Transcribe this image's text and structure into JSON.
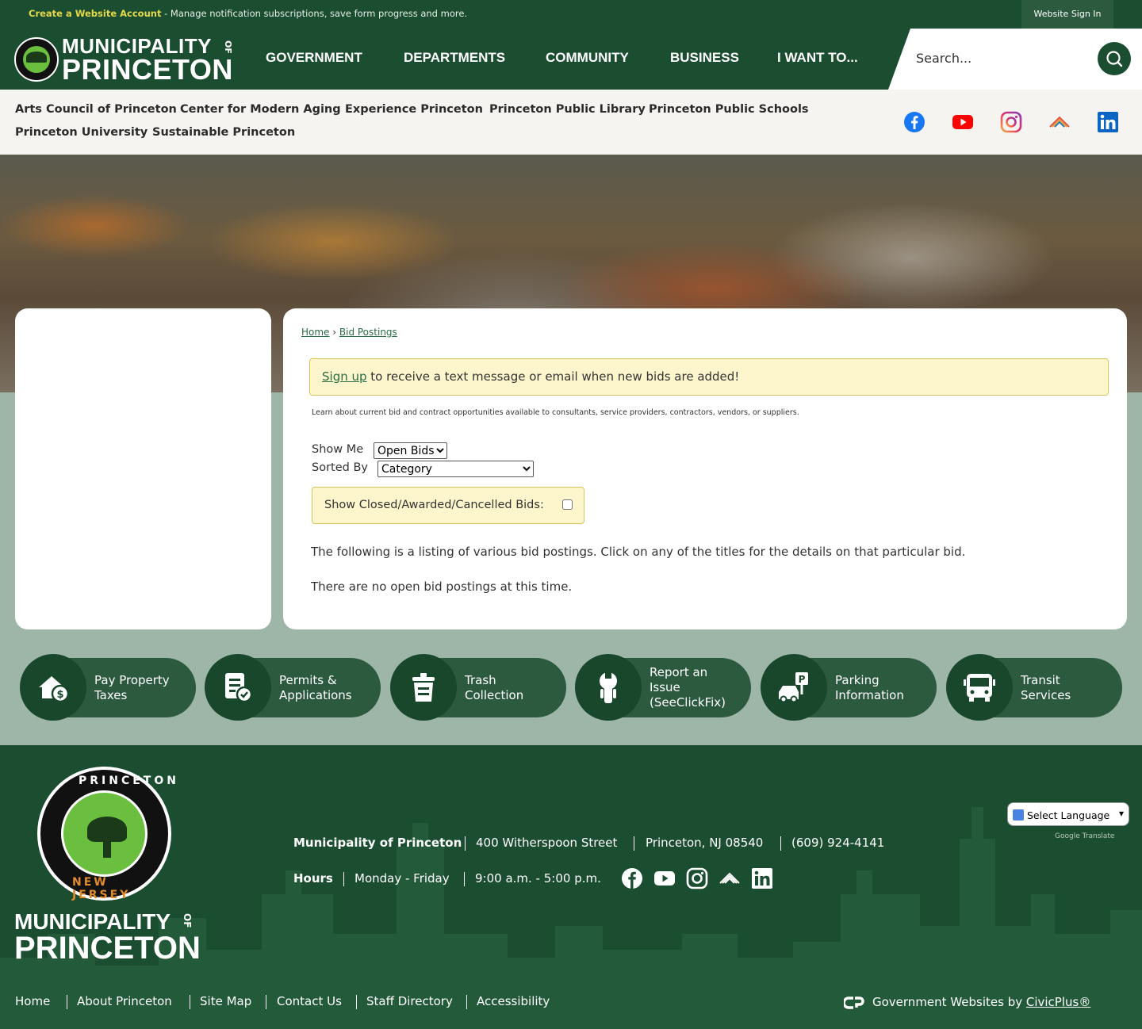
{
  "topbar": {
    "create_account": "Create a Website Account",
    "message": " - Manage notification subscriptions, save form progress and more.",
    "sign_in": "Website Sign In"
  },
  "header": {
    "logo_line1": "MUNICIPALITY",
    "logo_line2": "PRINCETON",
    "logo_of": "OF",
    "nav": [
      "GOVERNMENT",
      "DEPARTMENTS",
      "COMMUNITY",
      "BUSINESS",
      "I WANT TO..."
    ],
    "search_placeholder": "Search..."
  },
  "quick_links": [
    "Arts Council of Princeton",
    "Center for Modern Aging",
    "Experience Princeton",
    "Princeton Public Library",
    "Princeton Public Schools",
    "Princeton University",
    "Sustainable Princeton"
  ],
  "social_icons": [
    "facebook-icon",
    "youtube-icon",
    "instagram-icon",
    "nextdoor-icon",
    "linkedin-icon"
  ],
  "breadcrumb": {
    "home": "Home",
    "sep": " › ",
    "current": "Bid Postings"
  },
  "alert": {
    "link": "Sign up",
    "text": " to receive a text message or email when new bids are added!"
  },
  "learn_text": "Learn about current bid and contract opportunities available to consultants, service providers, contractors, vendors, or suppliers.",
  "filters": {
    "show_me_label": "Show Me",
    "show_me_value": "Open Bids",
    "sorted_by_label": "Sorted By",
    "sorted_by_value": "Category",
    "closed_label": "Show Closed/Awarded/Cancelled Bids:"
  },
  "listing_text": "The following is a listing of various bid postings. Click on any of the titles for the details on that particular bid.",
  "no_bids_text": "There are no open bid postings at this time.",
  "quick_actions": [
    {
      "label": "Pay Property Taxes",
      "line1": "Pay Property",
      "line2": "Taxes",
      "icon": "house-dollar-icon"
    },
    {
      "label": "Permits & Applications",
      "line1": "Permits &",
      "line2": "Applications",
      "icon": "permit-document-icon"
    },
    {
      "label": "Trash Collection",
      "line1": "Trash",
      "line2": "Collection",
      "icon": "trash-can-icon"
    },
    {
      "label": "Report an Issue (SeeClickFix)",
      "line1": "Report an",
      "line2": "Issue",
      "line3": "(SeeClickFix)",
      "icon": "wrench-icon"
    },
    {
      "label": "Parking Information",
      "line1": "Parking",
      "line2": "Information",
      "icon": "parking-car-icon"
    },
    {
      "label": "Transit Services",
      "line1": "Transit",
      "line2": "Services",
      "icon": "bus-icon"
    }
  ],
  "footer": {
    "seal_top": "PRINCETON",
    "seal_bottom": "NEW JERSEY",
    "name_line1": "MUNICIPALITY",
    "name_line2": "PRINCETON",
    "name_of": "OF",
    "org": "Municipality of Princeton",
    "street": "400 Witherspoon Street",
    "city": "Princeton, NJ 08540",
    "phone": "(609) 924-4141",
    "hours_label": "Hours",
    "days": "Monday - Friday",
    "time": "9:00 a.m. - 5:00 p.m.",
    "language": "Select Language",
    "powered": "Google Translate",
    "links": [
      "Home",
      "About Princeton",
      "Site Map",
      "Contact Us",
      "Staff Directory",
      "Accessibility"
    ],
    "civic_text": "Government Websites by ",
    "civic_link": "CivicPlus®"
  },
  "colors": {
    "brand_green": "#1b4d31",
    "accent_yellow": "#e4d84a",
    "alert_bg": "#fdf6cc",
    "page_bg": "#9eb6a8"
  }
}
